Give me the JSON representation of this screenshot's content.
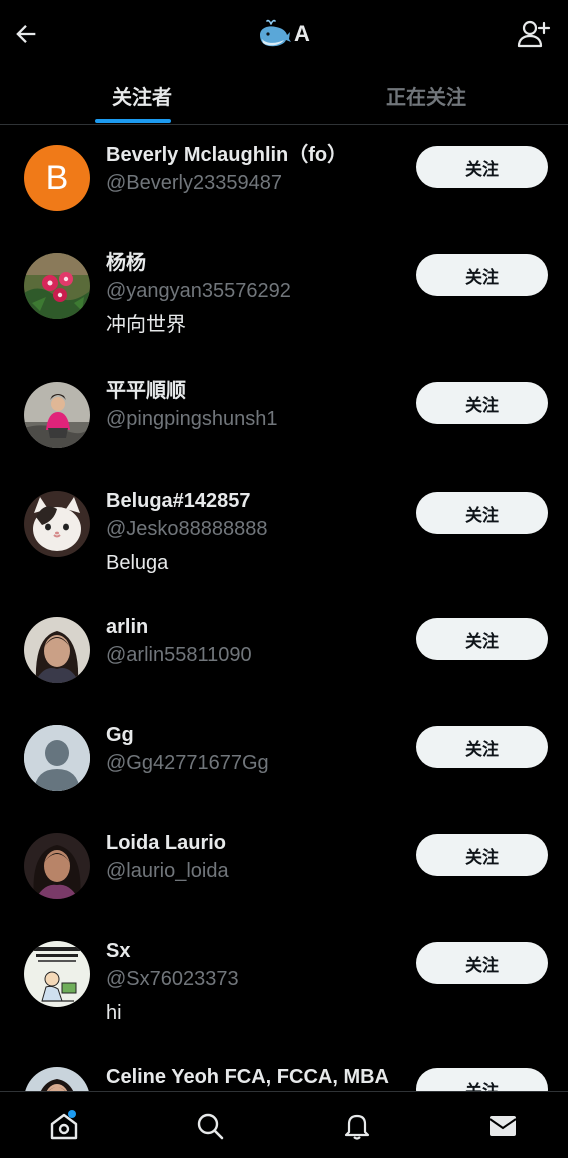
{
  "header": {
    "title": "A",
    "back_icon": "arrow-left-icon",
    "logo_icon": "whale-icon",
    "add_user_icon": "add-user-icon"
  },
  "tabs": [
    {
      "label": "关注者",
      "active": true
    },
    {
      "label": "正在关注",
      "active": false
    }
  ],
  "colors": {
    "accent": "#1d9bf0",
    "background": "#000000",
    "text_primary": "#e7e9ea",
    "text_secondary": "#71767b",
    "button_bg": "#eff3f4"
  },
  "users": [
    {
      "name": "Beverly Mclaughlin（fo）",
      "handle": "@Beverly23359487",
      "bio": "",
      "avatar": "letter-avatar",
      "avatar_letter": "B",
      "follow_label": "关注"
    },
    {
      "name": "杨杨",
      "handle": "@yangyan35576292",
      "bio": "冲向世界",
      "avatar": "flower-photo-avatar",
      "follow_label": "关注"
    },
    {
      "name": "平平順顺",
      "handle": "@pingpingshunsh1",
      "bio": "",
      "avatar": "person-photo-avatar",
      "follow_label": "关注"
    },
    {
      "name": "Beluga#142857",
      "handle": "@Jesko88888888",
      "bio": "Beluga",
      "avatar": "cat-photo-avatar",
      "follow_label": "关注"
    },
    {
      "name": "arlin",
      "handle": "@arlin55811090",
      "bio": "",
      "avatar": "woman-photo-avatar",
      "follow_label": "关注"
    },
    {
      "name": "Gg",
      "handle": "@Gg42771677Gg",
      "bio": "",
      "avatar": "default-avatar",
      "follow_label": "关注"
    },
    {
      "name": "Loida Laurio",
      "handle": "@laurio_loida",
      "bio": "",
      "avatar": "woman-photo-avatar",
      "follow_label": "关注"
    },
    {
      "name": "Sx",
      "handle": "@Sx76023373",
      "bio": "hi",
      "avatar": "cartoon-avatar",
      "follow_label": "关注"
    },
    {
      "name": "Celine Yeoh FCA, FCCA, MBA",
      "handle": "",
      "bio": "",
      "avatar": "woman-photo-avatar",
      "follow_label": "关注"
    }
  ],
  "bottom_nav": [
    {
      "name": "home",
      "icon": "home-icon",
      "has_badge": true
    },
    {
      "name": "search",
      "icon": "search-icon",
      "has_badge": false
    },
    {
      "name": "notifications",
      "icon": "bell-icon",
      "has_badge": false
    },
    {
      "name": "messages",
      "icon": "envelope-icon",
      "has_badge": false
    }
  ]
}
